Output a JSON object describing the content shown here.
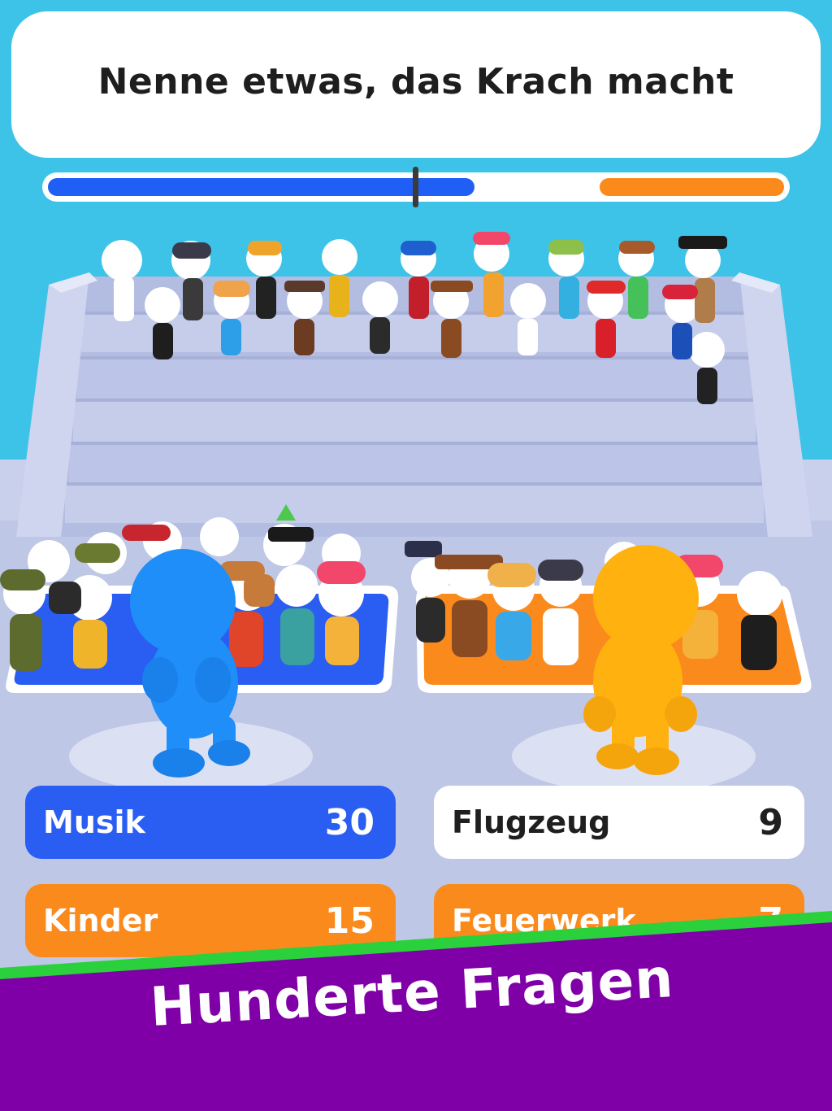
{
  "question": "Nenne etwas, das Krach macht",
  "scoreboard": {
    "blue_fraction": 0.58,
    "orange_fraction": 0.25,
    "marker_fraction": 0.5,
    "blue_color": "#1f5ff5",
    "orange_color": "#fb8a1d"
  },
  "answers": [
    {
      "label": "Musik",
      "points": "30",
      "style": "blue",
      "color": "#2a5df2"
    },
    {
      "label": "Flugzeug",
      "points": "9",
      "style": "white",
      "color": "#ffffff"
    },
    {
      "label": "Kinder",
      "points": "15",
      "style": "orange",
      "color": "#fb8a1d"
    },
    {
      "label": "Feuerwerk",
      "points": "7",
      "style": "orange",
      "color": "#fb8a1d"
    }
  ],
  "players": [
    {
      "name": "blue-player",
      "color": "#1f8ef8"
    },
    {
      "name": "orange-player",
      "color": "#ffb20f"
    }
  ],
  "banner": {
    "text": "Hunderte Fragen",
    "color": "#8000a8",
    "stripe_color": "#2ad13c"
  }
}
